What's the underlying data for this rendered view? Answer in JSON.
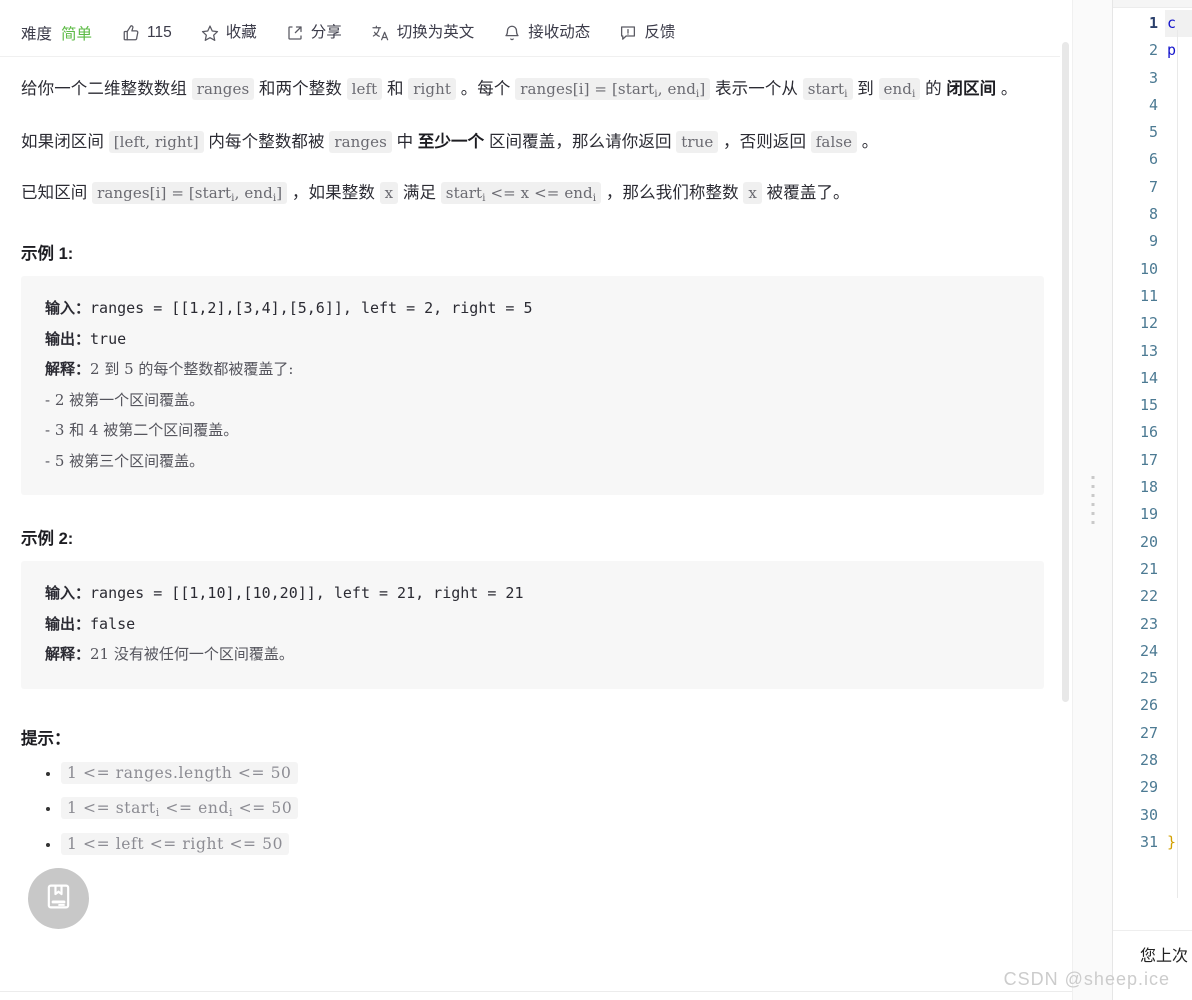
{
  "header": {
    "difficulty_label": "难度",
    "difficulty_value": "简单",
    "difficulty_color": "#5dbb46",
    "actions": [
      {
        "icon": "thumbs-up-icon",
        "label": "115"
      },
      {
        "icon": "star-icon",
        "label": "收藏"
      },
      {
        "icon": "share-icon",
        "label": "分享"
      },
      {
        "icon": "translate-icon",
        "label": "切换为英文"
      },
      {
        "icon": "bell-icon",
        "label": "接收动态"
      },
      {
        "icon": "feedback-icon",
        "label": "反馈"
      }
    ]
  },
  "description": {
    "p1": {
      "s1": "给你一个二维整数数组 ",
      "c1": "ranges",
      "s2": " 和两个整数 ",
      "c2": "left",
      "s3": " 和 ",
      "c3": "right",
      "s4": " 。每个 ",
      "c4": "ranges[i] = [start",
      "c4sub1": "i",
      "c4b": ", end",
      "c4sub2": "i",
      "c4c": "]",
      "s5": " 表示一个从 ",
      "c5": "start",
      "c5sub": "i",
      "s6": " 到 ",
      "c6": "end",
      "c6sub": "i",
      "s7": " 的 ",
      "bold1": "闭区间",
      "s8": " 。"
    },
    "p2": {
      "s1": "如果闭区间 ",
      "c1": "[left, right]",
      "s2": " 内每个整数都被 ",
      "c2": "ranges",
      "s3": " 中 ",
      "bold1": "至少一个",
      "s4": " 区间覆盖，那么请你返回 ",
      "c3": "true",
      "s5": " ，否则返回 ",
      "c4": "false",
      "s6": " 。"
    },
    "p3": {
      "s1": "已知区间 ",
      "c1": "ranges[i] = [start",
      "c1sub1": "i",
      "c1b": ", end",
      "c1sub2": "i",
      "c1c": "]",
      "s2": " ，如果整数 ",
      "c2": "x",
      "s3": " 满足 ",
      "c3": "start",
      "c3sub": "i",
      "c3b": " <= x <= end",
      "c3sub2": "i",
      "s4": " ，那么我们称整数 ",
      "c4": "x",
      "s5": " 被覆盖了。"
    }
  },
  "examples": [
    {
      "title": "示例 1:",
      "lines": [
        {
          "key": "输入：",
          "value": "ranges = [[1,2],[3,4],[5,6]], left = 2, right = 5"
        },
        {
          "key": "输出：",
          "value": "true"
        },
        {
          "key": "解释：",
          "value": "2 到 5 的每个整数都被覆盖了:",
          "cn": true
        },
        {
          "key": "",
          "value": "- 2 被第一个区间覆盖。",
          "cn": true
        },
        {
          "key": "",
          "value": "- 3 和 4 被第二个区间覆盖。",
          "cn": true
        },
        {
          "key": "",
          "value": "- 5 被第三个区间覆盖。",
          "cn": true
        }
      ]
    },
    {
      "title": "示例 2:",
      "lines": [
        {
          "key": "输入：",
          "value": "ranges = [[1,10],[10,20]], left = 21, right = 21"
        },
        {
          "key": "输出：",
          "value": "false"
        },
        {
          "key": "解释：",
          "value": "21 没有被任何一个区间覆盖。",
          "cn": true
        }
      ]
    }
  ],
  "hints": {
    "title": "提示：",
    "items": [
      {
        "pre": "1 <= ranges.length <= 50"
      },
      {
        "pre": "1 <= start",
        "sub1": "i",
        "mid": " <= end",
        "sub2": "i",
        "post": " <= 50"
      },
      {
        "pre": "1 <= left <= right <= 50"
      }
    ]
  },
  "editor": {
    "line_numbers": [
      "1",
      "2",
      "3",
      "4",
      "5",
      "6",
      "7",
      "8",
      "9",
      "10",
      "11",
      "12",
      "13",
      "14",
      "15",
      "16",
      "17",
      "18",
      "19",
      "20",
      "21",
      "22",
      "23",
      "24",
      "25",
      "26",
      "27",
      "28",
      "29",
      "30",
      "31"
    ],
    "current_line": "1",
    "code_lines": [
      "c",
      "p",
      "",
      "",
      "",
      "",
      "",
      "",
      "",
      "",
      "",
      "",
      "",
      "",
      "",
      "",
      "",
      "",
      "",
      "",
      "",
      "",
      "",
      "",
      "",
      "",
      "",
      "",
      "",
      "",
      "}"
    ],
    "keyword_color": "#1414cc",
    "brace_color": "#d2a000",
    "last_visit_text": "您上次"
  },
  "float_button": {
    "icon": "book-note-icon",
    "background": "#c8c8c8"
  },
  "watermark": {
    "text": "CSDN @sheep.ice"
  }
}
